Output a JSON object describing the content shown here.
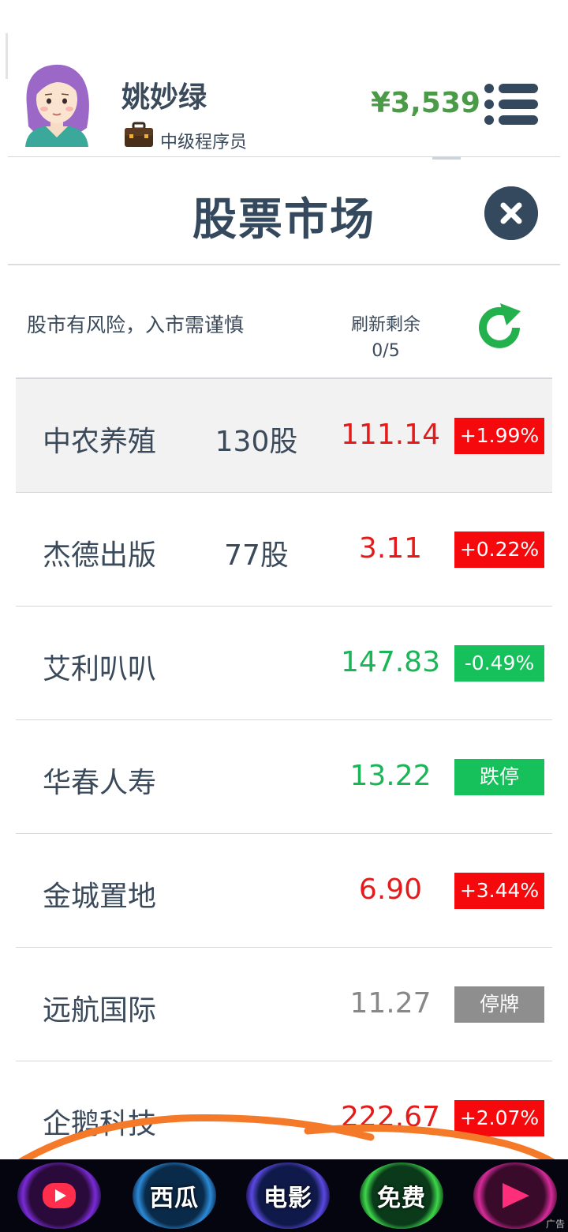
{
  "header": {
    "user_name": "姚妙绿",
    "job_title": "中级程序员",
    "balance": "¥3,539",
    "icons": {
      "avatar": "girl-avatar",
      "job": "briefcase-icon",
      "menu": "hamburger-menu-icon"
    }
  },
  "page": {
    "title": "股票市场",
    "close_icon": "close-icon"
  },
  "info": {
    "risk_warning": "股市有风险，入市需谨慎",
    "refresh_label": "刷新剩余",
    "refresh_count": "0/5",
    "refresh_icon": "refresh-icon"
  },
  "stocks": [
    {
      "name": "中农养殖",
      "shares": "130股",
      "price": "111.14",
      "change": "+1.99%",
      "trend": "up",
      "selected": true
    },
    {
      "name": "杰德出版",
      "shares": "77股",
      "price": "3.11",
      "change": "+0.22%",
      "trend": "up"
    },
    {
      "name": "艾利叭叭",
      "shares": "",
      "price": "147.83",
      "change": "-0.49%",
      "trend": "down"
    },
    {
      "name": "华春人寿",
      "shares": "",
      "price": "13.22",
      "change": "跌停",
      "trend": "down"
    },
    {
      "name": "金城置地",
      "shares": "",
      "price": "6.90",
      "change": "+3.44%",
      "trend": "up"
    },
    {
      "name": "远航国际",
      "shares": "",
      "price": "11.27",
      "change": "停牌",
      "trend": "halt"
    },
    {
      "name": "企鹅科技",
      "shares": "",
      "price": "222.67",
      "change": "+2.07%",
      "trend": "up"
    }
  ],
  "ad_bar": {
    "items": [
      "",
      "西瓜",
      "电影",
      "免费",
      ""
    ],
    "tag": "广告",
    "icons": [
      "video-app-icon",
      "",
      "",
      "",
      "play-icon"
    ]
  },
  "colors": {
    "up": "#f5090c",
    "down": "#16c05b",
    "halt": "#8e8e8e",
    "balance": "#4b9a48",
    "title": "#34495e"
  }
}
